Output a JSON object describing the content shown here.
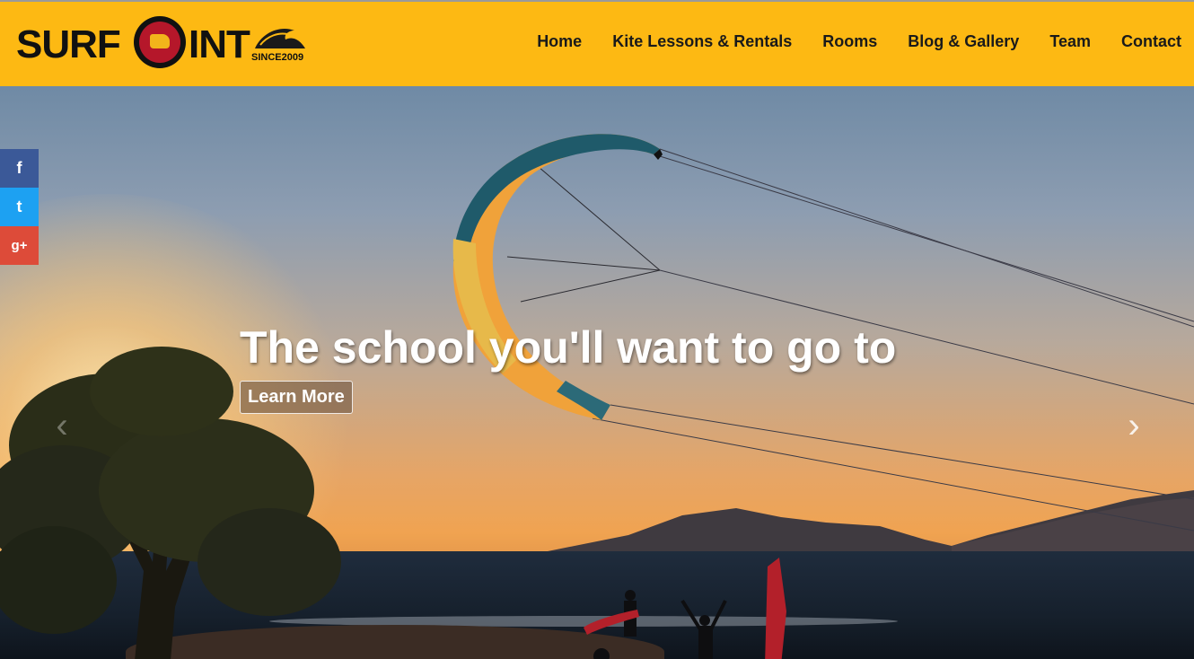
{
  "brand": {
    "logo_text_left": "SURF",
    "logo_text_right": "INT",
    "since": "SINCE2009",
    "color": "#fdb913"
  },
  "nav": {
    "items": [
      {
        "label": "Home"
      },
      {
        "label": "Kite Lessons & Rentals"
      },
      {
        "label": "Rooms"
      },
      {
        "label": "Blog & Gallery"
      },
      {
        "label": "Team"
      },
      {
        "label": "Contact"
      }
    ]
  },
  "hero": {
    "headline": "The school you'll want to go to",
    "button_label": "Learn More",
    "prev_icon": "chevron-left-icon",
    "next_icon": "chevron-right-icon"
  },
  "social": {
    "facebook": "f",
    "twitter": "t",
    "googleplus": "g+",
    "colors": {
      "facebook": "#3b5998",
      "twitter": "#1da1f2",
      "googleplus": "#dd4b39"
    }
  }
}
